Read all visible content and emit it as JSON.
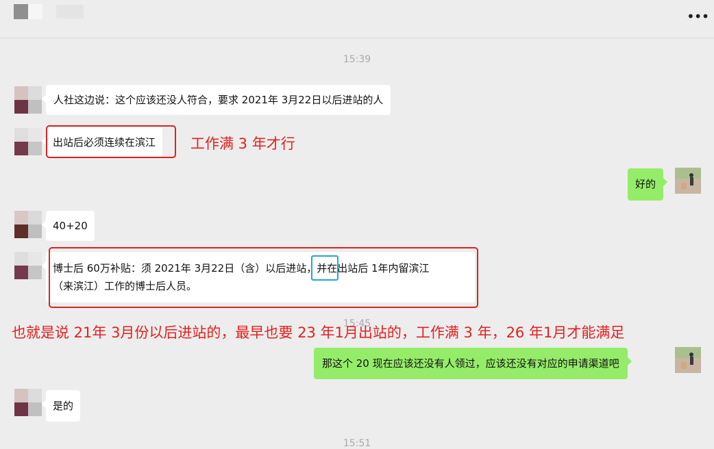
{
  "header": {
    "more_icon": "more-dots-icon",
    "more_label": "•••"
  },
  "times": [
    "15:39",
    "15:45",
    "15:51"
  ],
  "messages": [
    {
      "side": "in",
      "text": "人社这边说：这个应该还没人符合，要求 2021年 3月22日以后进站的人"
    },
    {
      "side": "in",
      "text": "出站后必须连续在滨江"
    },
    {
      "side": "out",
      "text": "好的"
    },
    {
      "side": "in",
      "text": "40+20"
    },
    {
      "side": "in",
      "line1": "博士后 60万补贴：须 2021年 3月22日（含）以后进站，并在出站后 1年内留滨江",
      "line2": "（来滨江）工作的博士后人员。"
    },
    {
      "side": "out",
      "text": "那这个 20 现在应该还没有人领过，应该还没有对应的申请渠道吧"
    },
    {
      "side": "in",
      "text": "是的"
    }
  ],
  "annotations": {
    "note1": "工作满 3 年才行",
    "note2": "也就是说 21年 3月份以后进站的，最早也要 23 年1月出站的，工作满 3 年，26 年1月才能满足"
  },
  "colors": {
    "background": "#ededed",
    "incoming_bubble": "#ffffff",
    "outgoing_bubble": "#95ec69",
    "annotation_red": "#e4201e",
    "highlight_blue": "#21a4dc"
  }
}
